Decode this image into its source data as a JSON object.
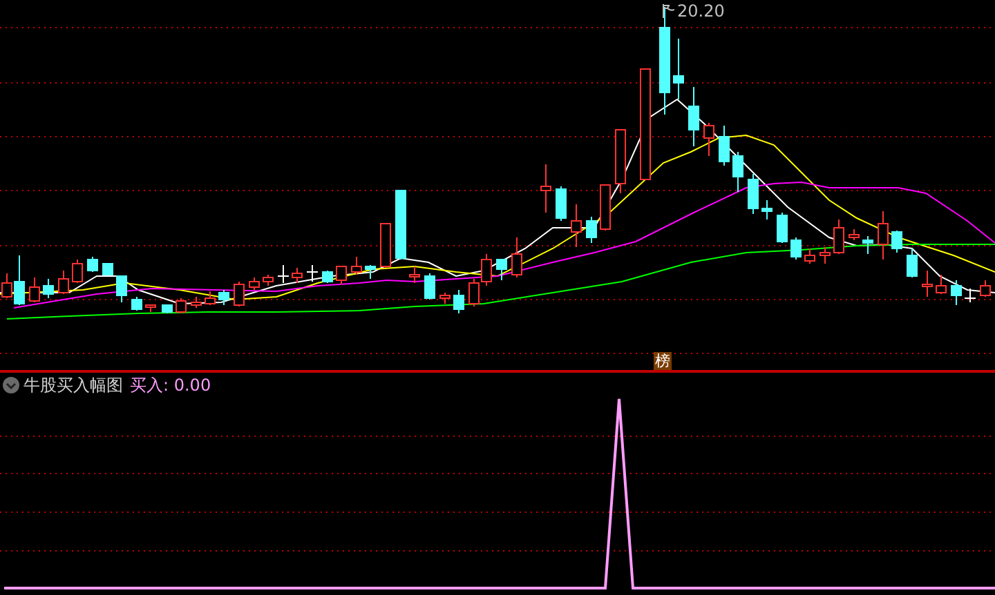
{
  "price_chart": {
    "peak_label": "20.20",
    "badge": "榜"
  },
  "indicator": {
    "title": "牛股买入幅图",
    "reading": "买入: 0.00"
  }
}
